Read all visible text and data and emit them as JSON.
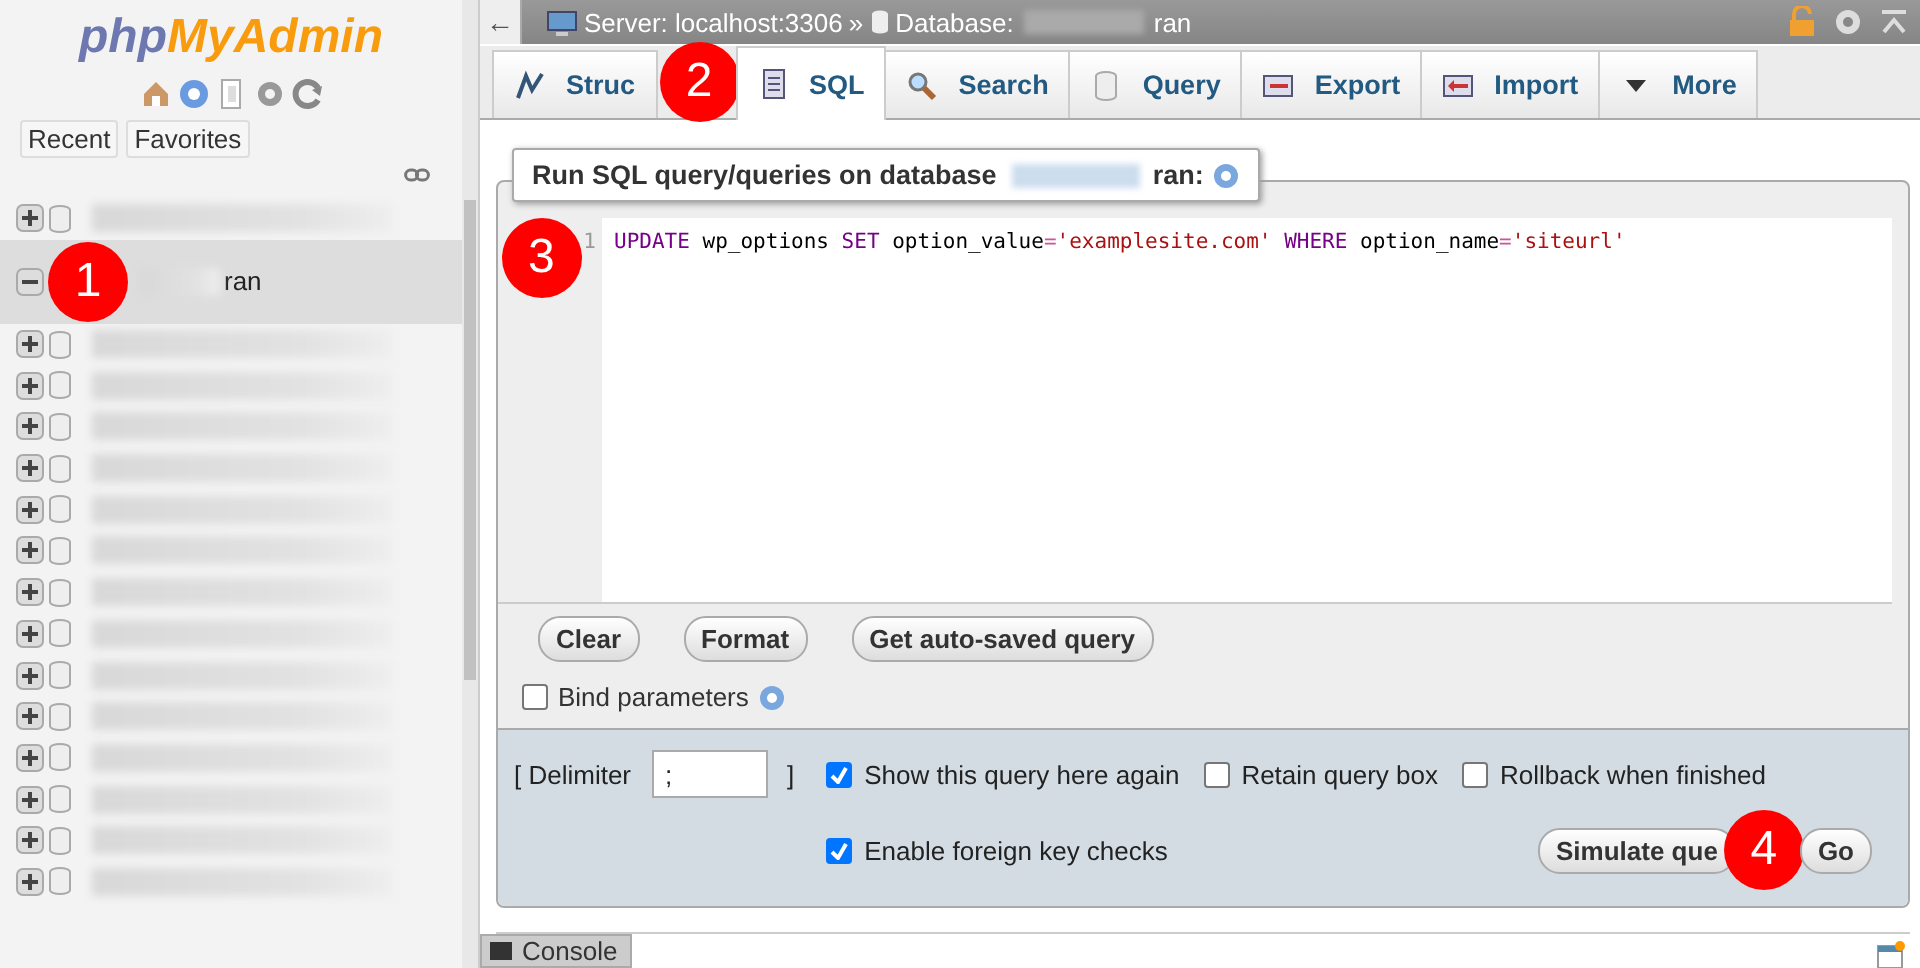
{
  "sidebar": {
    "logo": {
      "first": "php",
      "second": "MyAdmin"
    },
    "buttons": [
      "Recent",
      "Favorites"
    ],
    "databases": [
      {
        "expanded": false,
        "selected": false
      },
      {
        "name": "ran",
        "expanded": true,
        "selected": true
      },
      {
        "expanded": false,
        "selected": false
      },
      {
        "expanded": false,
        "selected": false
      },
      {
        "expanded": false,
        "selected": false
      },
      {
        "expanded": false,
        "selected": false
      },
      {
        "expanded": false,
        "selected": false
      },
      {
        "expanded": false,
        "selected": false
      },
      {
        "expanded": false,
        "selected": false
      },
      {
        "expanded": false,
        "selected": false
      },
      {
        "expanded": false,
        "selected": false
      },
      {
        "expanded": false,
        "selected": false
      },
      {
        "expanded": false,
        "selected": false
      },
      {
        "expanded": false,
        "selected": false
      },
      {
        "expanded": false,
        "selected": false
      },
      {
        "expanded": false,
        "selected": false
      }
    ]
  },
  "topbar": {
    "back": "←",
    "server": "Server: localhost:3306",
    "separator": "»",
    "database_label": "Database:",
    "database_name": "ran"
  },
  "tabs": [
    {
      "kind": "structure",
      "label": "Struc",
      "selected": false
    },
    {
      "kind": "sql",
      "label": "SQL",
      "selected": true
    },
    {
      "kind": "search",
      "label": "Search",
      "selected": false
    },
    {
      "kind": "query",
      "label": "Query",
      "selected": false
    },
    {
      "kind": "export",
      "label": "Export",
      "selected": false
    },
    {
      "kind": "import",
      "label": "Import",
      "selected": false
    },
    {
      "kind": "more",
      "label": "More",
      "selected": false
    }
  ],
  "query_panel": {
    "title": "Run SQL query/queries on database",
    "title_db": "ran:",
    "line_number": "1",
    "sql": [
      {
        "kind": "keyword",
        "text": "UPDATE"
      },
      {
        "kind": "plain",
        "text": " wp_options "
      },
      {
        "kind": "keyword",
        "text": "SET"
      },
      {
        "kind": "plain",
        "text": " option_value"
      },
      {
        "kind": "operator",
        "text": "="
      },
      {
        "kind": "string",
        "text": "'examplesite.com'"
      },
      {
        "kind": "keyword",
        "text": " WHERE"
      },
      {
        "kind": "plain",
        "text": " option_name"
      },
      {
        "kind": "operator",
        "text": "="
      },
      {
        "kind": "string",
        "text": "'siteurl'"
      }
    ],
    "buttons": [
      "Clear",
      "Format",
      "Get auto-saved query"
    ],
    "bind_parameters": {
      "label": "Bind parameters",
      "checked": false
    }
  },
  "options": {
    "delimiter_label": "[ Delimiter",
    "delimiter_value": ";",
    "delimiter_close": "]",
    "checkboxes": [
      {
        "label": "Show this query here again",
        "checked": true
      },
      {
        "label": "Retain query box",
        "checked": false
      },
      {
        "label": "Rollback when finished",
        "checked": false
      },
      {
        "label": "Enable foreign key checks",
        "checked": true
      }
    ],
    "buttons": [
      "Simulate que",
      "Go"
    ]
  },
  "console": "Console",
  "annotations": [
    {
      "kind": "sidebar",
      "text": "1"
    },
    {
      "kind": "tabs",
      "text": "2"
    },
    {
      "kind": "editor",
      "text": "3"
    },
    {
      "kind": "submit",
      "text": "4"
    }
  ]
}
